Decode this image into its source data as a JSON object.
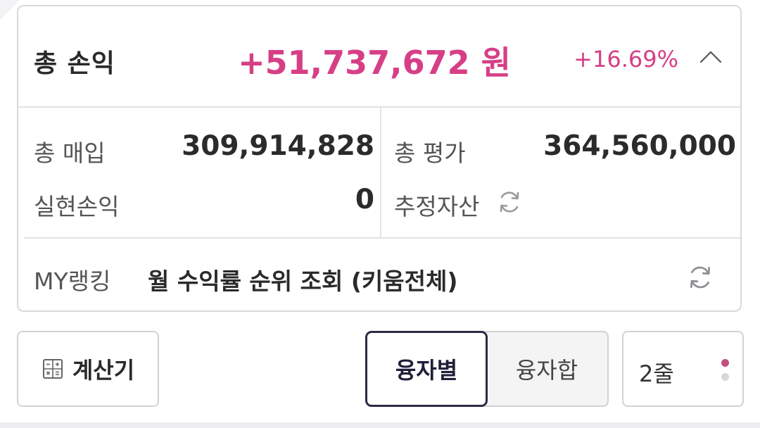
{
  "summary": {
    "title": "총 손익",
    "amount": "+51,737,672 원",
    "rate": "+16.69%",
    "profit_color": "#d63f86",
    "collapse_icon": "chevron-up-icon"
  },
  "metrics": {
    "total_purchase_label": "총 매입",
    "total_purchase_value": "309,914,828",
    "realized_pl_label": "실현손익",
    "realized_pl_value": "0",
    "total_eval_label": "총 평가",
    "total_eval_value": "364,560,000",
    "estimated_assets_label": "추정자산",
    "refresh_icon": "refresh-icon"
  },
  "ranking": {
    "label": "MY랭킹",
    "text": "월 수익률 순위 조회 (키움전체)",
    "refresh_icon": "refresh-icon"
  },
  "toolbar": {
    "calculator_label": "계산기",
    "calculator_icon": "calculator-icon",
    "segments": [
      {
        "label": "융자별",
        "selected": true
      },
      {
        "label": "융자합",
        "selected": false
      }
    ],
    "lines_label": "2줄",
    "page_dots_active_color": "#c0507f",
    "page_dots_inactive_color": "#d8d8db"
  }
}
